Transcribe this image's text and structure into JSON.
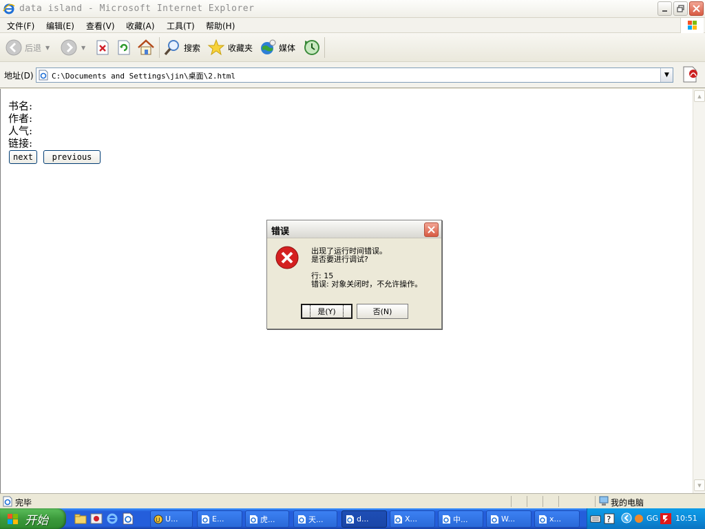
{
  "window": {
    "title": "data island - Microsoft Internet Explorer"
  },
  "menu": {
    "items": [
      "文件(F)",
      "编辑(E)",
      "查看(V)",
      "收藏(A)",
      "工具(T)",
      "帮助(H)"
    ]
  },
  "toolbar": {
    "back_label": "后退",
    "search_label": "搜索",
    "favorites_label": "收藏夹",
    "media_label": "媒体"
  },
  "address": {
    "label": "地址(D)",
    "url": "C:\\Documents and Settings\\jin\\桌面\\2.html"
  },
  "page": {
    "fields": [
      {
        "label": "书名:"
      },
      {
        "label": "作者:"
      },
      {
        "label": "人气:"
      },
      {
        "label": "链接:"
      }
    ],
    "next_label": "next",
    "previous_label": "previous"
  },
  "dialog": {
    "title": "错误",
    "line1": "出现了运行时间错误。",
    "line2": "是否要进行调试?",
    "line_label": "行: 15",
    "error_text": "错误: 对象关闭时，不允许操作。",
    "yes_label": "是(Y)",
    "no_label": "否(N)"
  },
  "statusbar": {
    "status": "完毕",
    "zone": "我的电脑"
  },
  "taskbar": {
    "start_label": "开始",
    "tasks": [
      "U...",
      "E...",
      "虎...",
      "天...",
      "d...",
      "X...",
      "中...",
      "W...",
      "x..."
    ],
    "active_task_index": 4,
    "clock": "10:51",
    "tray_text": "GG"
  },
  "colors": {
    "taskbar_blue": "#245edb",
    "start_green": "#3c9a3c",
    "close_red": "#d85b43",
    "error_red": "#d42020"
  }
}
